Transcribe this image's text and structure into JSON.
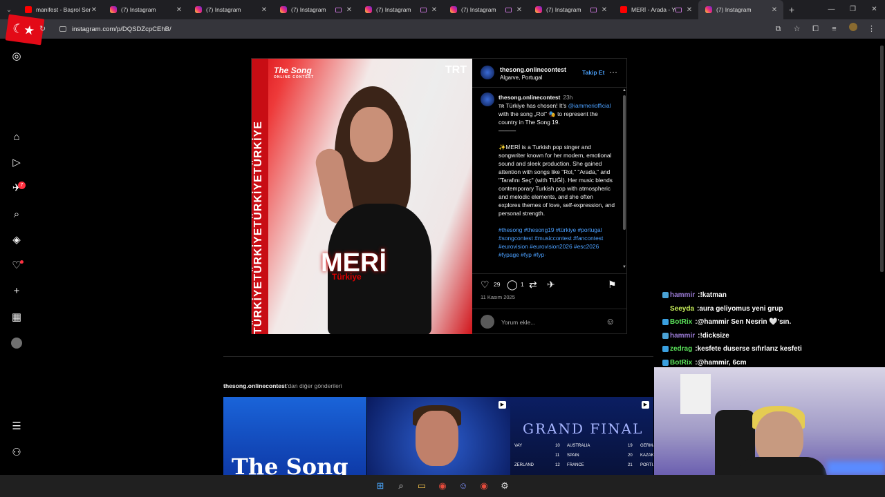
{
  "tabs": [
    {
      "title": "manifest - Başrol Sen",
      "favicon": "youtube-icon",
      "has_media": false
    },
    {
      "title": "(7) Instagram",
      "favicon": "instagram-icon",
      "has_media": false
    },
    {
      "title": "(7) Instagram",
      "favicon": "instagram-icon",
      "has_media": false
    },
    {
      "title": "(7) Instagram",
      "favicon": "instagram-icon",
      "has_media": true
    },
    {
      "title": "(7) Instagram",
      "favicon": "instagram-icon",
      "has_media": true
    },
    {
      "title": "(7) Instagram",
      "favicon": "instagram-icon",
      "has_media": true
    },
    {
      "title": "(7) Instagram",
      "favicon": "instagram-icon",
      "has_media": true
    },
    {
      "title": "MERİ - Arada - YouTu",
      "favicon": "youtube-icon",
      "has_media": true
    },
    {
      "title": "(7) Instagram",
      "favicon": "instagram-icon",
      "has_media": false,
      "active": true
    }
  ],
  "address": {
    "url": "instagram.com/p/DQSDZcpCEhB/"
  },
  "nav": {
    "notifications_badge": "7"
  },
  "post": {
    "image": {
      "vertical_text": "TÜRKİYETÜRKİYETÜRKİYETÜRKİYE",
      "logo": "The Song",
      "logo_sub": "ONLINE CONTEST",
      "trt": "TRT",
      "name": "MERİ",
      "country": "Türkiye"
    },
    "header": {
      "account": "thesong.onlinecontest",
      "location": "Algarve, Portugal",
      "follow": "Takip Et",
      "more": "···"
    },
    "caption": {
      "username": "thesong.onlinecontest",
      "time": "23h",
      "line1_a": "ᴛʀ Türkiye has chosen! It's",
      "mention": "@iammeriofficial",
      "line1_b": " with the song „Rol\" 🎭 to represent the country in The Song 19.",
      "divider": "———",
      "bio": "✨MERİ is a Turkish pop singer and songwriter known for her modern, emotional sound and sleek production. She gained attention with songs like \"Rol,\" \"Arada,\" and \"Tarafını Seç\" (with TUĞİ). Her music blends contemporary Turkish pop with atmospheric and melodic elements, and she often explores themes of love, self-expression, and personal strength.",
      "hashtags": "#thesong #thesong19 #türkiye #portugal #songcontest #musiccontest #fancontest #eurovision #eurovision2026 #esc2026 #fypage #fyp #fyp·"
    },
    "likes": "29",
    "comments": "1",
    "date": "11 Kasım 2025",
    "comment_placeholder": "Yorum ekle..."
  },
  "more_posts": {
    "account": "thesong.onlinecontest",
    "suffix": "'dan diğer gönderileri",
    "thumb1_logo": "The Song",
    "thumb3_title": "GRAND FINAL",
    "thumb3_rows": [
      {
        "a": "VAY",
        "n1": "10",
        "c1": "AUSTRALIA",
        "n2": "19",
        "c2": "GERMA"
      },
      {
        "a": "",
        "n1": "11",
        "c1": "SPAIN",
        "n2": "20",
        "c2": "KAZAK"
      },
      {
        "a": "ZERLAND",
        "n1": "12",
        "c1": "FRANCE",
        "n2": "21",
        "c2": "PORTU"
      }
    ]
  },
  "chat": [
    {
      "user": "hammir",
      "msg": "!katman",
      "color": "#9b7bd6",
      "badge_color": "#4aa3d6"
    },
    {
      "user": "Seeyda",
      "msg": "aura geliyomus yeni grup",
      "color": "#c8f05a",
      "badge_color": ""
    },
    {
      "user": "BotRix",
      "msg": "@hammir Sen Nesrin 🤍'sın.",
      "color": "#5ce65c",
      "badge_color": "#3aa0e0"
    },
    {
      "user": "hammir",
      "msg": "!dicksize",
      "color": "#9b7bd6",
      "badge_color": "#4aa3d6"
    },
    {
      "user": "zedrag",
      "msg": "kesfete duserse sıfırlarız kesfeti",
      "color": "#5ce65c",
      "badge_color": "#3aa0e0"
    },
    {
      "user": "BotRix",
      "msg": "@hammir, 6cm",
      "color": "#5ce65c",
      "badge_color": "#3aa0e0"
    }
  ],
  "colors": {
    "accent_link": "#4a9ff8",
    "instagram_red": "#ff3040",
    "background": "#000000"
  }
}
